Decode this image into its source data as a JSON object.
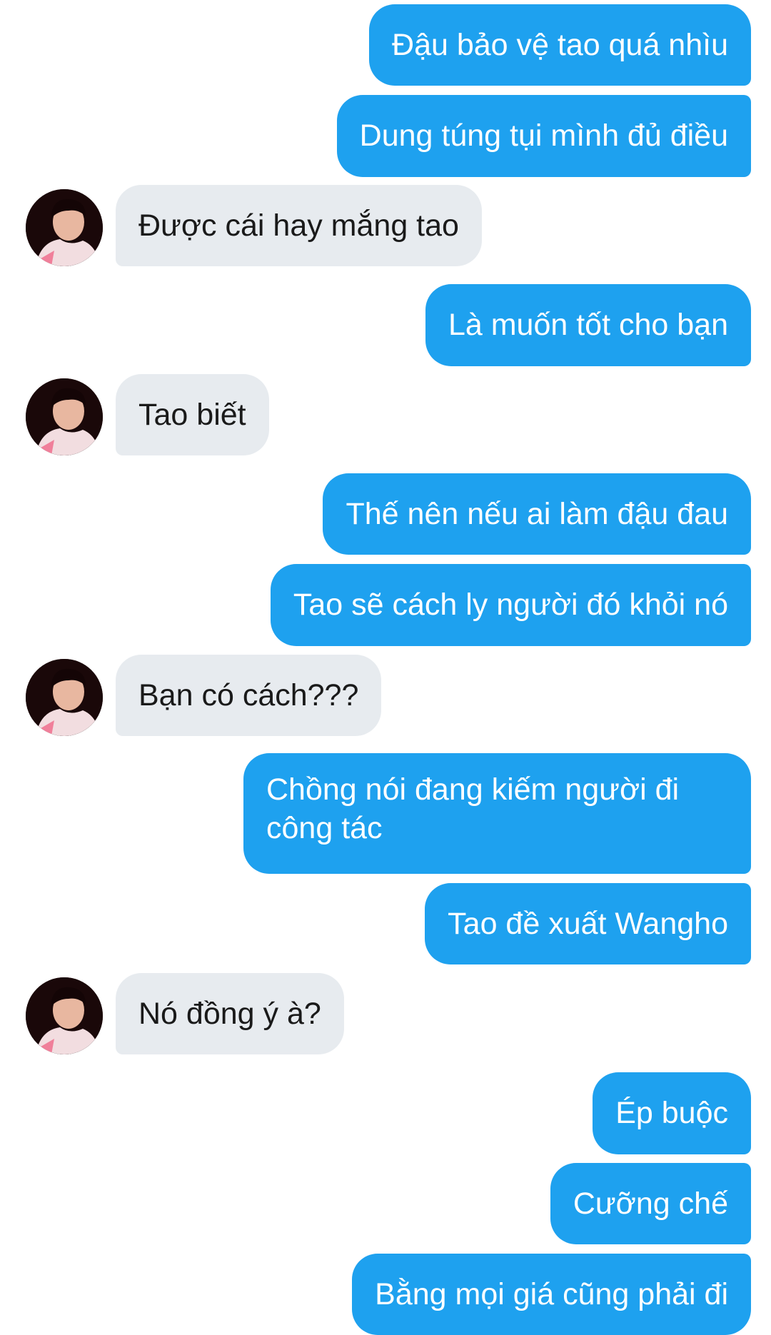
{
  "conversation": {
    "messages": [
      {
        "sender": "me",
        "text": "Đậu bảo vệ tao quá nhìu"
      },
      {
        "sender": "me",
        "text": "Dung túng tụi mình đủ điều"
      },
      {
        "sender": "other",
        "text": "Được cái hay mắng tao"
      },
      {
        "sender": "me",
        "text": "Là muốn tốt cho bạn"
      },
      {
        "sender": "other",
        "text": "Tao biết"
      },
      {
        "sender": "me",
        "text": "Thế nên nếu ai làm đậu đau"
      },
      {
        "sender": "me",
        "text": "Tao sẽ cách ly người đó khỏi nó"
      },
      {
        "sender": "other",
        "text": "Bạn có cách???"
      },
      {
        "sender": "me",
        "text": "Chồng nói đang kiếm người đi công tác"
      },
      {
        "sender": "me",
        "text": "Tao đề xuất Wangho"
      },
      {
        "sender": "other",
        "text": "Nó đồng ý à?"
      },
      {
        "sender": "me",
        "text": "Ép buộc"
      },
      {
        "sender": "me",
        "text": "Cưỡng chế"
      },
      {
        "sender": "me",
        "text": "Bằng mọi giá cũng phải đi"
      }
    ]
  },
  "colors": {
    "outgoing_bubble": "#1ea1ef",
    "incoming_bubble": "#e7ebef",
    "outgoing_text": "#ffffff",
    "incoming_text": "#1a1a1a"
  },
  "icons": {
    "avatar": "contact-avatar-photo"
  }
}
